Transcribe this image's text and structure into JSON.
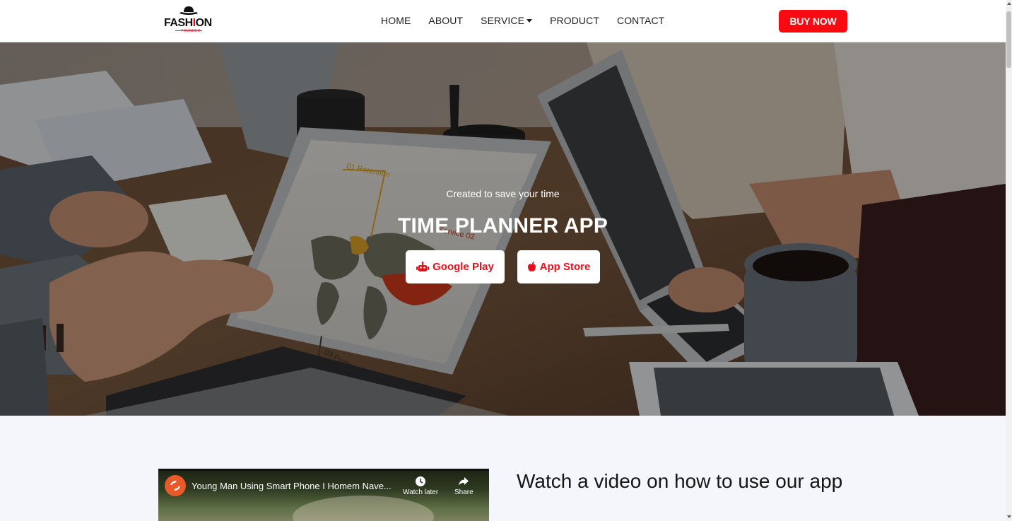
{
  "header": {
    "logo": {
      "word_start": "FASH",
      "word_accent": "I",
      "word_end": "ON",
      "tagline": "THUNDER"
    },
    "nav": [
      {
        "label": "HOME",
        "icon": null
      },
      {
        "label": "ABOUT",
        "icon": null
      },
      {
        "label": "SERVICE",
        "icon": "caret-down-icon"
      },
      {
        "label": "PRODUCT",
        "icon": null
      },
      {
        "label": "CONTACT",
        "icon": null
      }
    ],
    "buy_label": "BUY NOW"
  },
  "hero": {
    "subtitle": "Created to save your time",
    "title": "TIME PLANNER APP",
    "buttons": [
      {
        "label": "Google Play",
        "icon": "android-icon"
      },
      {
        "label": "App Store",
        "icon": "apple-icon"
      }
    ],
    "screen_labels": [
      "01 Retention",
      "Service 02",
      "03 Profitability"
    ]
  },
  "video": {
    "title": "Young Man Using Smart Phone I Homem Nave...",
    "watch_later": "Watch later",
    "share": "Share"
  },
  "section": {
    "heading": "Watch a video on how to use our app"
  },
  "colors": {
    "accent": "#f80a12",
    "hero_text": "#ffffff",
    "page_bg": "#f5f6fb"
  }
}
